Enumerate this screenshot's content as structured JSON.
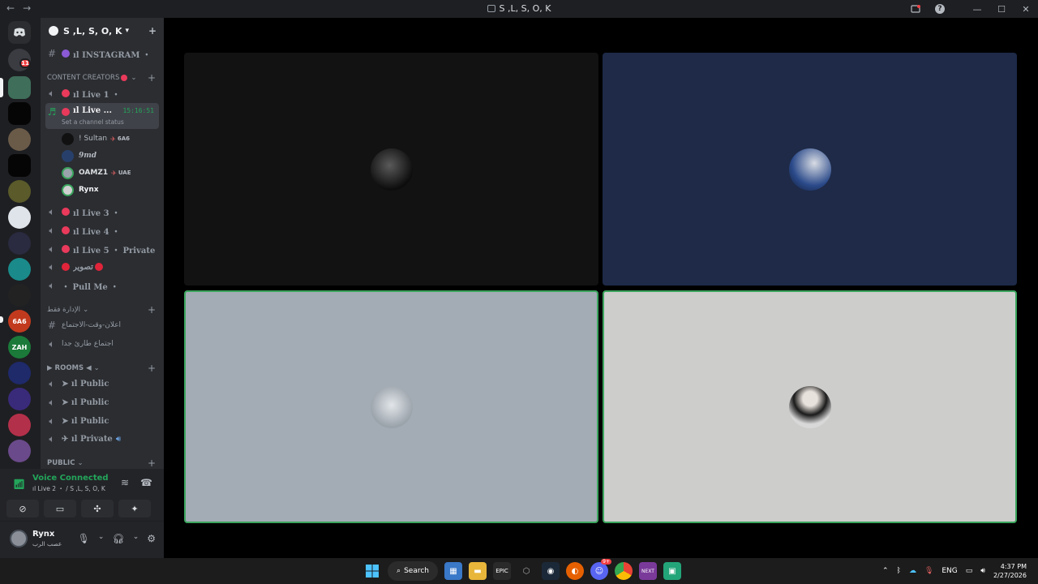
{
  "window": {
    "title": "S ,L, S, O, K"
  },
  "titlebar": {
    "back_icon": "←",
    "forward_icon": "→",
    "help_icon": "?",
    "minimize_icon": "—",
    "maximize_icon": "☐",
    "close_icon": "✕"
  },
  "guilds": {
    "badge_count": "11",
    "zah_label": "ZAH",
    "s6_label": "6A6"
  },
  "server": {
    "name": "S ,L, S, O, K"
  },
  "channels": {
    "instagram": "ıl INSTAGRAM ・",
    "content_creators_category": "CONTENT CREATORS",
    "live1": "ıl Live 1 ・",
    "live2": "ıl Live ...",
    "live2_time": "15:16:51",
    "live2_status": "Set a channel status",
    "voice_users": [
      {
        "name": "! Sultan",
        "tag": "6A6"
      },
      {
        "name": "9md",
        "tag": ""
      },
      {
        "name": "OAMZ1",
        "tag": "UAE"
      },
      {
        "name": "Rynx",
        "tag": ""
      }
    ],
    "live3": "ıl Live 3 ・",
    "live4": "ıl Live 4 ・",
    "live5": "ıl Live 5 ・ Private",
    "photography": "تصوير",
    "pull_me": "・ Pull Me ・",
    "admin_category": "الإدارة فقط",
    "meeting_announce": "اعلان-وقت-الاجتماع",
    "urgent_meeting": "اجتماع طارئ جدا",
    "rooms_category": "ROOMS",
    "public1": "➤ ıl Public",
    "public2": "➤ ıl Public",
    "public3": "➤ ıl Public",
    "private": "✈ ıl Private",
    "public_category": "PUBLIC"
  },
  "voice_panel": {
    "status": "Voice Connected",
    "location": "ıl Live 2 ・ / S ,L, S, O, K"
  },
  "user_panel": {
    "name": "Rynx",
    "status": "عصب الرب"
  },
  "taskbar": {
    "search_label": "Search",
    "lang": "ENG",
    "time": "4:37 PM",
    "date": "2/27/2026",
    "discord_badge": "9+"
  },
  "colors": {
    "accent_green": "#23a55a",
    "speaking_border": "#3ba55d",
    "live_red": "#e93a5b"
  }
}
